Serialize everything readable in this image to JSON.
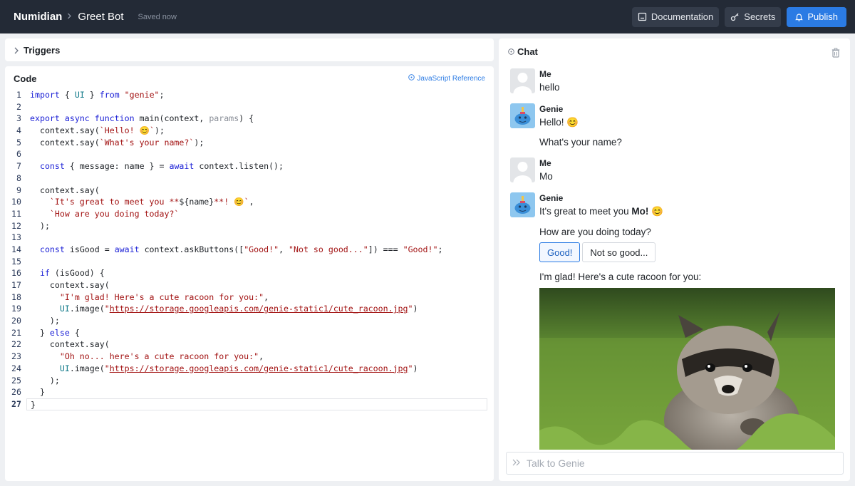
{
  "header": {
    "brand": "Numidian",
    "bot_name": "Greet Bot",
    "saved_status": "Saved now",
    "documentation_label": "Documentation",
    "secrets_label": "Secrets",
    "publish_label": "Publish"
  },
  "triggers": {
    "label": "Triggers"
  },
  "code_panel": {
    "title": "Code",
    "reference_link": "JavaScript Reference",
    "current_line": 27,
    "lines": [
      [
        [
          "kw",
          "import"
        ],
        [
          "t",
          " { "
        ],
        [
          "cls",
          "UI"
        ],
        [
          "t",
          " } "
        ],
        [
          "kw",
          "from"
        ],
        [
          "t",
          " "
        ],
        [
          "str",
          "\"genie\""
        ],
        [
          "t",
          ";"
        ]
      ],
      [],
      [
        [
          "kw",
          "export"
        ],
        [
          "t",
          " "
        ],
        [
          "kw",
          "async"
        ],
        [
          "t",
          " "
        ],
        [
          "kw",
          "function"
        ],
        [
          "t",
          " main(context, "
        ],
        [
          "prm",
          "params"
        ],
        [
          "t",
          ") {"
        ]
      ],
      [
        [
          "t",
          "  context.say("
        ],
        [
          "str",
          "`Hello! 😊`"
        ],
        [
          "t",
          ");"
        ]
      ],
      [
        [
          "t",
          "  context.say("
        ],
        [
          "str",
          "`What's your name?`"
        ],
        [
          "t",
          ");"
        ]
      ],
      [],
      [
        [
          "t",
          "  "
        ],
        [
          "kw",
          "const"
        ],
        [
          "t",
          " { message: name } = "
        ],
        [
          "kw",
          "await"
        ],
        [
          "t",
          " context.listen();"
        ]
      ],
      [],
      [
        [
          "t",
          "  context.say("
        ]
      ],
      [
        [
          "t",
          "    "
        ],
        [
          "str",
          "`It's great to meet you **"
        ],
        [
          "t",
          "${name}"
        ],
        [
          "str",
          "**! 😊`"
        ],
        [
          "t",
          ","
        ]
      ],
      [
        [
          "t",
          "    "
        ],
        [
          "str",
          "`How are you doing today?`"
        ]
      ],
      [
        [
          "t",
          "  );"
        ]
      ],
      [],
      [
        [
          "t",
          "  "
        ],
        [
          "kw",
          "const"
        ],
        [
          "t",
          " isGood = "
        ],
        [
          "kw",
          "await"
        ],
        [
          "t",
          " context.askButtons(["
        ],
        [
          "str",
          "\"Good!\""
        ],
        [
          "t",
          ", "
        ],
        [
          "str",
          "\"Not so good...\""
        ],
        [
          "t",
          "]) === "
        ],
        [
          "str",
          "\"Good!\""
        ],
        [
          "t",
          ";"
        ]
      ],
      [],
      [
        [
          "t",
          "  "
        ],
        [
          "kw",
          "if"
        ],
        [
          "t",
          " (isGood) {"
        ]
      ],
      [
        [
          "t",
          "    context.say("
        ]
      ],
      [
        [
          "t",
          "      "
        ],
        [
          "str",
          "\"I'm glad! Here's a cute racoon for you:\""
        ],
        [
          "t",
          ","
        ]
      ],
      [
        [
          "t",
          "      "
        ],
        [
          "cls",
          "UI"
        ],
        [
          "t",
          ".image("
        ],
        [
          "str",
          "\""
        ],
        [
          "url",
          "https://storage.googleapis.com/genie-static1/cute_racoon.jpg"
        ],
        [
          "str",
          "\""
        ],
        [
          "t",
          ")"
        ]
      ],
      [
        [
          "t",
          "    );"
        ]
      ],
      [
        [
          "t",
          "  } "
        ],
        [
          "kw",
          "else"
        ],
        [
          "t",
          " {"
        ]
      ],
      [
        [
          "t",
          "    context.say("
        ]
      ],
      [
        [
          "t",
          "      "
        ],
        [
          "str",
          "\"Oh no... here's a cute racoon for you:\""
        ],
        [
          "t",
          ","
        ]
      ],
      [
        [
          "t",
          "      "
        ],
        [
          "cls",
          "UI"
        ],
        [
          "t",
          ".image("
        ],
        [
          "str",
          "\""
        ],
        [
          "url",
          "https://storage.googleapis.com/genie-static1/cute_racoon.jpg"
        ],
        [
          "str",
          "\""
        ],
        [
          "t",
          ")"
        ]
      ],
      [
        [
          "t",
          "    );"
        ]
      ],
      [
        [
          "t",
          "  }"
        ]
      ],
      [
        [
          "t",
          "}"
        ]
      ]
    ]
  },
  "chat": {
    "title": "Chat",
    "messages": [
      {
        "sender": "Me",
        "text": "hello"
      },
      {
        "sender": "Genie",
        "text": "Hello! 😊",
        "text2": "What's your name?"
      },
      {
        "sender": "Me",
        "text": "Mo"
      },
      {
        "sender": "Genie",
        "text_pre": "It's great to meet you ",
        "text_bold": "Mo!",
        "text_post": " 😊",
        "text2": "How are you doing today?"
      }
    ],
    "buttons": [
      "Good!",
      "Not so good..."
    ],
    "selected_button": "Good!",
    "followup": "I'm glad! Here's a cute racoon for you:",
    "input_placeholder": "Talk to Genie"
  }
}
